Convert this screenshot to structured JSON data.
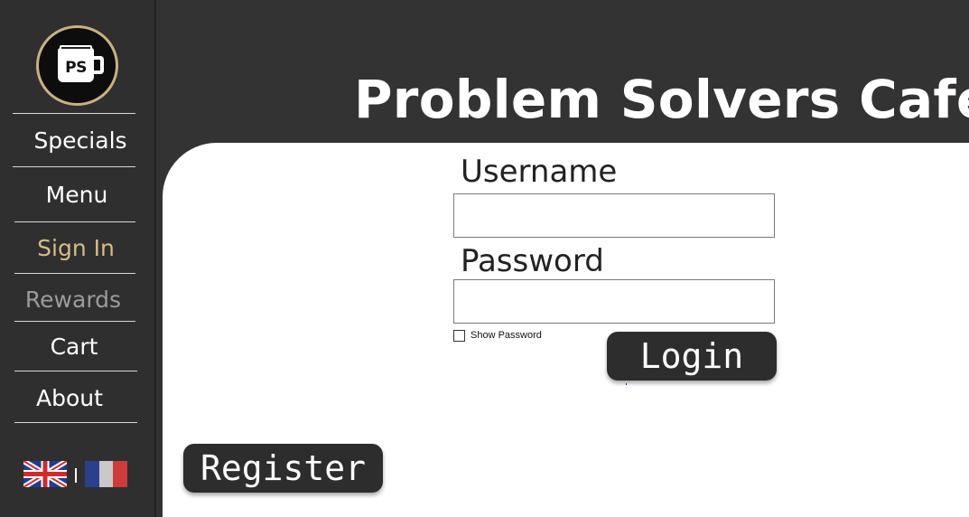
{
  "app": {
    "title": "Problem Solvers Café;",
    "logo_text": "PS"
  },
  "window_controls": [
    "close",
    "minimize",
    "maximize"
  ],
  "sidebar": {
    "items": [
      {
        "label": "Specials",
        "state": "normal"
      },
      {
        "label": "Menu",
        "state": "normal"
      },
      {
        "label": "Sign In",
        "state": "active"
      },
      {
        "label": "Rewards",
        "state": "disabled"
      },
      {
        "label": "Cart",
        "state": "normal"
      },
      {
        "label": "About",
        "state": "normal"
      }
    ],
    "languages": {
      "separator": "|",
      "options": [
        "english-flag-icon",
        "french-flag-icon"
      ]
    }
  },
  "login_form": {
    "username_label": "Username",
    "username_value": "",
    "password_label": "Password",
    "password_value": "",
    "show_password_label": "Show Password",
    "show_password_checked": false,
    "login_button": "Login",
    "register_button": "Register"
  },
  "colors": {
    "background": "#333333",
    "accent_active": "#d6bd86",
    "disabled": "#9c9c9c",
    "button": "#2d2d2d",
    "content": "#ffffff"
  }
}
